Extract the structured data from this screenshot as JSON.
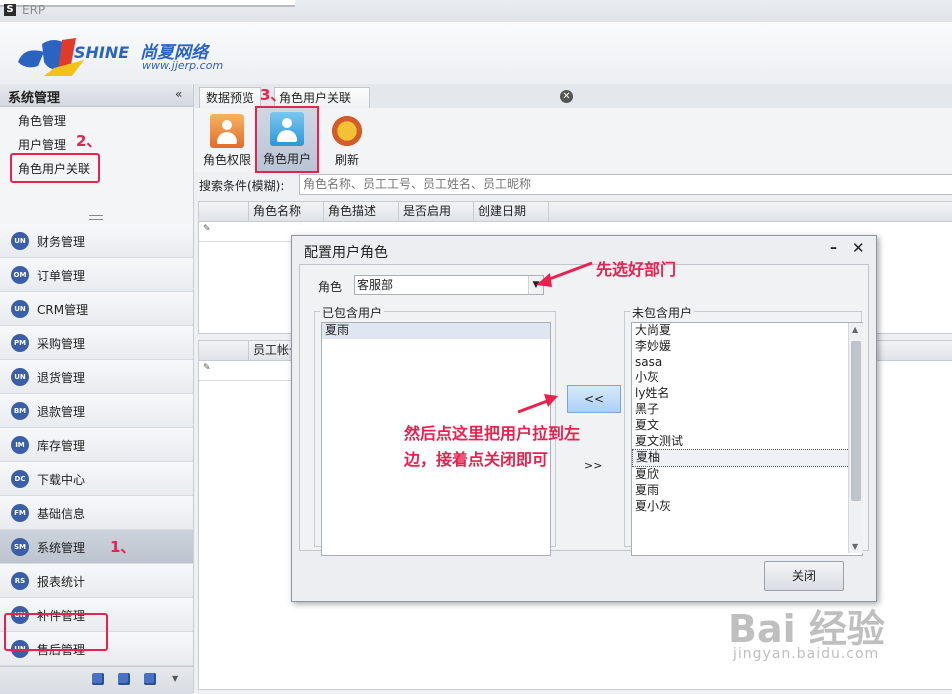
{
  "window": {
    "logo_letter": "S",
    "title": "ERP"
  },
  "brand": {
    "logo_text": "SUNSHINE",
    "chinese_name": "尚夏网络",
    "url": "www.jjerp.com"
  },
  "sidebar": {
    "header": "系统管理",
    "collapse_icon": "«",
    "subitems": [
      "角色管理",
      "用户管理",
      "角色用户关联"
    ],
    "annotation_sub": "2、",
    "modules": [
      {
        "icon": "UN",
        "label": "财务管理"
      },
      {
        "icon": "OM",
        "label": "订单管理"
      },
      {
        "icon": "UN",
        "label": "CRM管理"
      },
      {
        "icon": "PM",
        "label": "采购管理"
      },
      {
        "icon": "UN",
        "label": "退货管理"
      },
      {
        "icon": "BM",
        "label": "退款管理"
      },
      {
        "icon": "IM",
        "label": "库存管理"
      },
      {
        "icon": "DC",
        "label": "下载中心"
      },
      {
        "icon": "FM",
        "label": "基础信息"
      },
      {
        "icon": "SM",
        "label": "系统管理"
      },
      {
        "icon": "RS",
        "label": "报表统计"
      },
      {
        "icon": "UN",
        "label": "补件管理"
      },
      {
        "icon": "UN",
        "label": "售后管理"
      }
    ],
    "annotation_module": "1、",
    "active_module": 9
  },
  "tabs": [
    {
      "label": "数据预览"
    },
    {
      "label": "角色用户关联"
    }
  ],
  "annotation_tab": "3、",
  "toolbar": {
    "btn_permission": "角色权限",
    "btn_user": "角色用户",
    "btn_refresh": "刷新"
  },
  "search": {
    "label": "搜索条件(模糊):",
    "placeholder": "角色名称、员工工号、员工姓名、员工昵称"
  },
  "grid_top": {
    "columns": [
      "角色名称",
      "角色描述",
      "是否启用",
      "创建日期"
    ]
  },
  "grid_bottom": {
    "columns": [
      "员工帐号"
    ]
  },
  "dialog": {
    "title": "配置用户角色",
    "min": "–",
    "close": "✕",
    "role_label": "角色",
    "role_value": "客服部",
    "included_title": "已包含用户",
    "included_users": [
      "夏雨"
    ],
    "excluded_title": "未包含用户",
    "excluded_users": [
      "大尚夏",
      "李妙媛",
      "sasa",
      "小灰",
      "ly姓名",
      "黑子",
      "夏文",
      "夏文测试",
      "夏柚",
      "夏欣",
      "夏雨",
      "夏小灰"
    ],
    "add_button": "<<",
    "remove_button": ">>",
    "close_button": "关闭"
  },
  "notes": {
    "select_dept": "先选好部门",
    "drag_line1": "然后点这里把用户拉到左",
    "drag_line2": "边，接着点关闭即可"
  },
  "watermark": {
    "brand": "Bai 经验",
    "url": "jingyan.baidu.com"
  },
  "colors": {
    "annotation": "#e8214f",
    "accent": "#3a5fa8"
  }
}
